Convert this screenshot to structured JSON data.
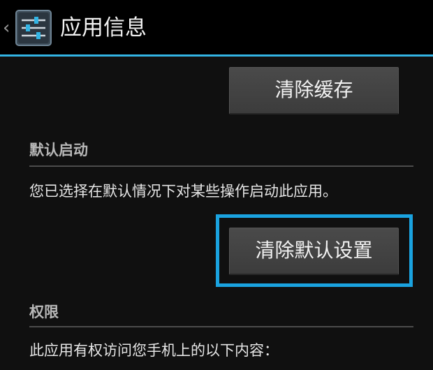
{
  "action_bar": {
    "up_icon": "chevron-left-icon",
    "app_icon": "settings-sliders-icon",
    "title": "应用信息"
  },
  "storage": {
    "clear_cache_label": "清除缓存"
  },
  "launch_by_default": {
    "header": "默认启动",
    "description": "您已选择在默认情况下对某些操作启动此应用。",
    "clear_defaults_label": "清除默认设置"
  },
  "permissions": {
    "header": "权限",
    "description": "此应用有权访问您手机上的以下内容："
  },
  "colors": {
    "accent": "#33b5e5",
    "highlight_border": "#1aa3e0",
    "background": "#101010",
    "button": "#444444"
  }
}
